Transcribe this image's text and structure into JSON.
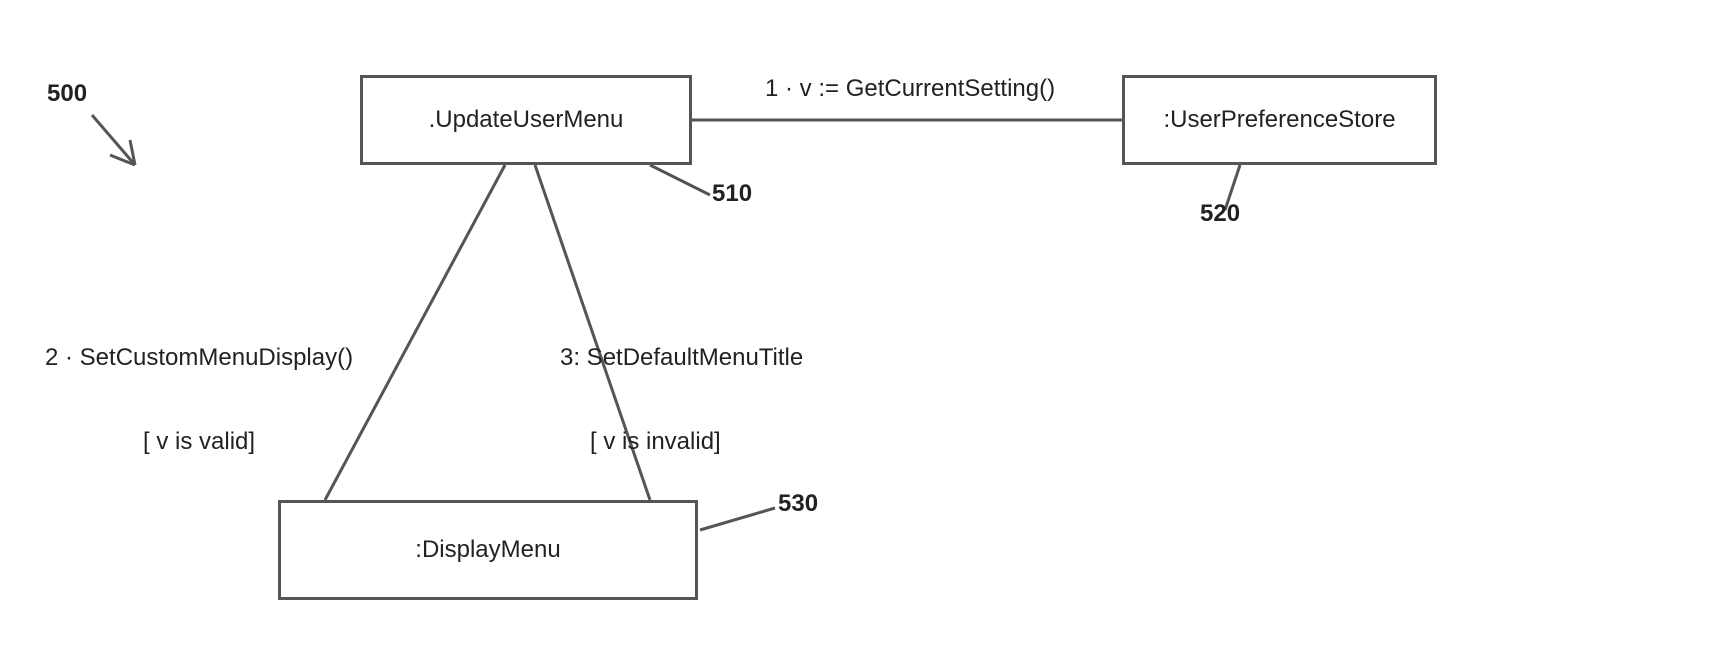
{
  "diagramRef": "500",
  "boxes": {
    "updateUserMenu": {
      "label": ".UpdateUserMenu",
      "ref": "510"
    },
    "userPreferenceStore": {
      "label": ":UserPreferenceStore",
      "ref": "520"
    },
    "displayMenu": {
      "label": ":DisplayMenu",
      "ref": "530"
    }
  },
  "messages": {
    "msg1": "1 · v := GetCurrentSetting()",
    "msg2": {
      "line1": "2 · SetCustomMenuDisplay()",
      "line2": "[ v is valid]"
    },
    "msg3": {
      "line1": "3: SetDefaultMenuTitle",
      "line2": "[ v is invalid]"
    }
  }
}
